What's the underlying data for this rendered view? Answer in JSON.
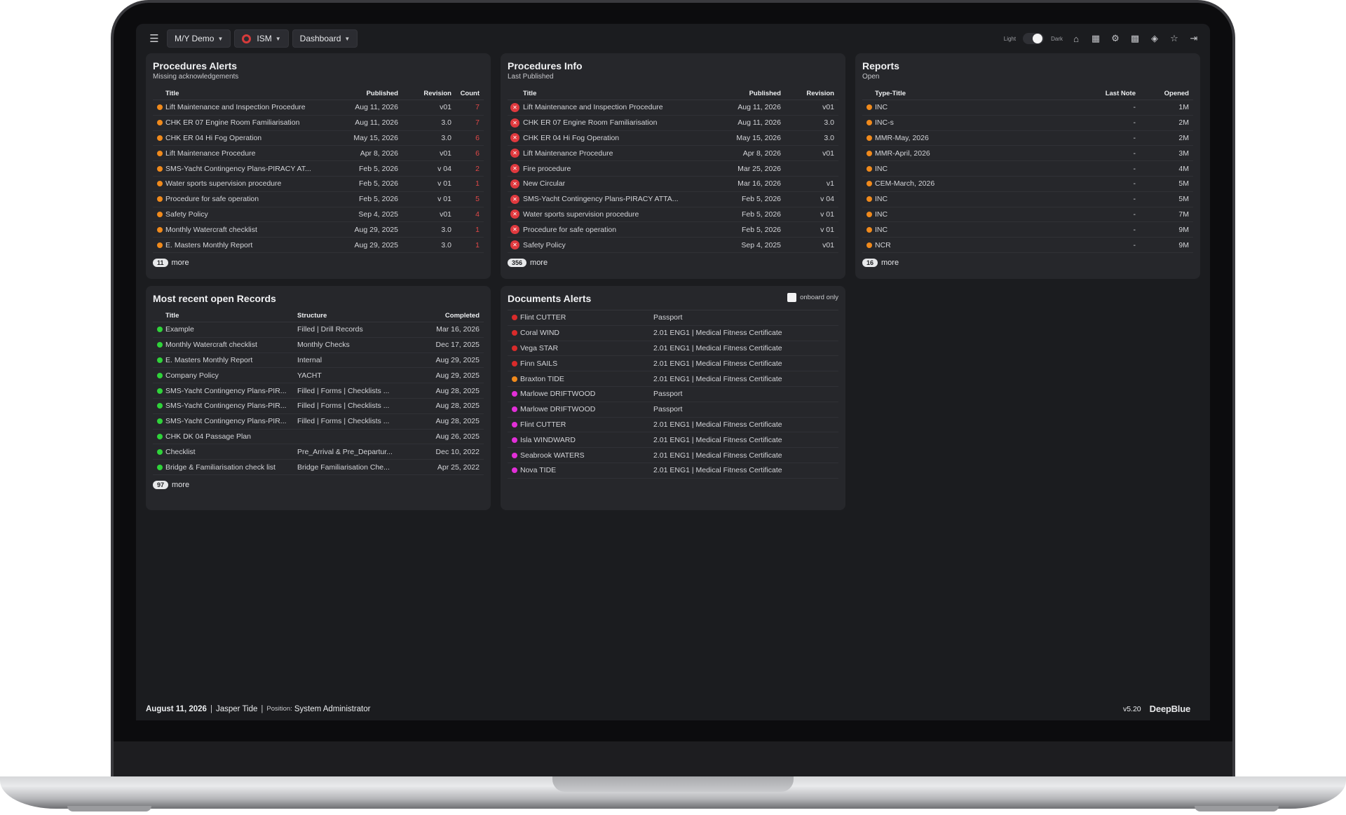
{
  "topbar": {
    "vessel": "M/Y Demo",
    "module": "ISM",
    "view": "Dashboard",
    "theme_light": "Light",
    "theme_dark": "Dark"
  },
  "procedures_alerts": {
    "title": "Procedures Alerts",
    "subtitle": "Missing acknowledgements",
    "headers": [
      "Title",
      "Published",
      "Revision",
      "Count"
    ],
    "rows": [
      {
        "title": "Lift Maintenance and Inspection Procedure",
        "published": "Aug 11, 2026",
        "revision": "v01",
        "count": "7"
      },
      {
        "title": "CHK ER 07 Engine Room Familiarisation",
        "published": "Aug 11, 2026",
        "revision": "3.0",
        "count": "7"
      },
      {
        "title": "CHK ER 04 Hi Fog Operation",
        "published": "May 15, 2026",
        "revision": "3.0",
        "count": "6"
      },
      {
        "title": "Lift Maintenance Procedure",
        "published": "Apr 8, 2026",
        "revision": "v01",
        "count": "6"
      },
      {
        "title": "SMS-Yacht Contingency Plans-PIRACY AT...",
        "published": "Feb 5, 2026",
        "revision": "v 04",
        "count": "2"
      },
      {
        "title": "Water sports supervision procedure",
        "published": "Feb 5, 2026",
        "revision": "v 01",
        "count": "1"
      },
      {
        "title": "Procedure for safe operation",
        "published": "Feb 5, 2026",
        "revision": "v 01",
        "count": "5"
      },
      {
        "title": "Safety Policy",
        "published": "Sep 4, 2025",
        "revision": "v01",
        "count": "4"
      },
      {
        "title": "Monthly Watercraft checklist",
        "published": "Aug 29, 2025",
        "revision": "3.0",
        "count": "1"
      },
      {
        "title": "E. Masters Monthly Report",
        "published": "Aug 29, 2025",
        "revision": "3.0",
        "count": "1"
      }
    ],
    "more_count": "11",
    "more_label": "more"
  },
  "procedures_info": {
    "title": "Procedures Info",
    "subtitle": "Last Published",
    "headers": [
      "Title",
      "Published",
      "Revision"
    ],
    "rows": [
      {
        "title": "Lift Maintenance and Inspection Procedure",
        "published": "Aug 11, 2026",
        "revision": "v01"
      },
      {
        "title": "CHK ER 07 Engine Room Familiarisation",
        "published": "Aug 11, 2026",
        "revision": "3.0"
      },
      {
        "title": "CHK ER 04 Hi Fog Operation",
        "published": "May 15, 2026",
        "revision": "3.0"
      },
      {
        "title": "Lift Maintenance Procedure",
        "published": "Apr 8, 2026",
        "revision": "v01"
      },
      {
        "title": "Fire procedure",
        "published": "Mar 25, 2026",
        "revision": ""
      },
      {
        "title": "New Circular",
        "published": "Mar 16, 2026",
        "revision": "v1"
      },
      {
        "title": "SMS-Yacht Contingency Plans-PIRACY ATTA...",
        "published": "Feb 5, 2026",
        "revision": "v 04"
      },
      {
        "title": "Water sports supervision procedure",
        "published": "Feb 5, 2026",
        "revision": "v 01"
      },
      {
        "title": "Procedure for safe operation",
        "published": "Feb 5, 2026",
        "revision": "v 01"
      },
      {
        "title": "Safety Policy",
        "published": "Sep 4, 2025",
        "revision": "v01"
      }
    ],
    "more_count": "356",
    "more_label": "more"
  },
  "reports": {
    "title": "Reports",
    "subtitle": "Open",
    "headers": [
      "Type-Title",
      "Last Note",
      "Opened"
    ],
    "rows": [
      {
        "title": "INC",
        "last_note": "-",
        "opened": "1M"
      },
      {
        "title": "INC-s",
        "last_note": "-",
        "opened": "2M"
      },
      {
        "title": "MMR-May, 2026",
        "last_note": "-",
        "opened": "2M"
      },
      {
        "title": "MMR-April, 2026",
        "last_note": "-",
        "opened": "3M"
      },
      {
        "title": "INC",
        "last_note": "-",
        "opened": "4M"
      },
      {
        "title": "CEM-March, 2026",
        "last_note": "-",
        "opened": "5M"
      },
      {
        "title": "INC",
        "last_note": "-",
        "opened": "5M"
      },
      {
        "title": "INC",
        "last_note": "-",
        "opened": "7M"
      },
      {
        "title": "INC",
        "last_note": "-",
        "opened": "9M"
      },
      {
        "title": "NCR",
        "last_note": "-",
        "opened": "9M"
      }
    ],
    "more_count": "16",
    "more_label": "more"
  },
  "records": {
    "title": "Most recent open Records",
    "headers": [
      "Title",
      "Structure",
      "Completed"
    ],
    "rows": [
      {
        "title": "Example",
        "structure": "Filled | Drill Records",
        "completed": "Mar 16, 2026"
      },
      {
        "title": "Monthly Watercraft checklist",
        "structure": "Monthly Checks",
        "completed": "Dec 17, 2025"
      },
      {
        "title": "E. Masters Monthly Report",
        "structure": "Internal",
        "completed": "Aug 29, 2025"
      },
      {
        "title": "Company Policy",
        "structure": "YACHT",
        "completed": "Aug 29, 2025"
      },
      {
        "title": "SMS-Yacht Contingency Plans-PIR...",
        "structure": "Filled | Forms | Checklists ...",
        "completed": "Aug 28, 2025"
      },
      {
        "title": "SMS-Yacht Contingency Plans-PIR...",
        "structure": "Filled | Forms | Checklists ...",
        "completed": "Aug 28, 2025"
      },
      {
        "title": "SMS-Yacht Contingency Plans-PIR...",
        "structure": "Filled | Forms | Checklists ...",
        "completed": "Aug 28, 2025"
      },
      {
        "title": "CHK DK 04 Passage Plan",
        "structure": "",
        "completed": "Aug 26, 2025"
      },
      {
        "title": "Checklist",
        "structure": "Pre_Arrival & Pre_Departur...",
        "completed": "Dec 10, 2022"
      },
      {
        "title": "Bridge & Familiarisation check list",
        "structure": "Bridge Familiarisation Che...",
        "completed": "Apr 25, 2022"
      }
    ],
    "more_count": "97",
    "more_label": "more"
  },
  "documents_alerts": {
    "title": "Documents Alerts",
    "onboard_label": "onboard only",
    "rows": [
      {
        "name": "Flint CUTTER",
        "document": "Passport",
        "color": "#d92b2b"
      },
      {
        "name": "Coral WIND",
        "document": "2.01 ENG1 | Medical Fitness Certificate",
        "color": "#d92b2b"
      },
      {
        "name": "Vega STAR",
        "document": "2.01 ENG1 | Medical Fitness Certificate",
        "color": "#d92b2b"
      },
      {
        "name": "Finn SAILS",
        "document": "2.01 ENG1 | Medical Fitness Certificate",
        "color": "#d92b2b"
      },
      {
        "name": "Braxton TIDE",
        "document": "2.01 ENG1 | Medical Fitness Certificate",
        "color": "#f08a1c"
      },
      {
        "name": "Marlowe DRIFTWOOD",
        "document": "Passport",
        "color": "#e22fd8"
      },
      {
        "name": "Marlowe DRIFTWOOD",
        "document": "Passport",
        "color": "#e22fd8"
      },
      {
        "name": "Flint CUTTER",
        "document": "2.01 ENG1 | Medical Fitness Certificate",
        "color": "#e22fd8"
      },
      {
        "name": "Isla WINDWARD",
        "document": "2.01 ENG1 | Medical Fitness Certificate",
        "color": "#e22fd8"
      },
      {
        "name": "Seabrook WATERS",
        "document": "2.01 ENG1 | Medical Fitness Certificate",
        "color": "#e22fd8"
      },
      {
        "name": "Nova TIDE",
        "document": "2.01 ENG1 | Medical Fitness Certificate",
        "color": "#e22fd8"
      }
    ]
  },
  "footer": {
    "date": "August 11, 2026",
    "user": "Jasper Tide",
    "position_label": "Position:",
    "position": "System Administrator",
    "version": "v5.20",
    "brand": "DeepBlue"
  },
  "colors": {
    "orange_dot": "#f08a1c",
    "green_dot": "#2fd33a",
    "red_alert": "#e0393e"
  }
}
